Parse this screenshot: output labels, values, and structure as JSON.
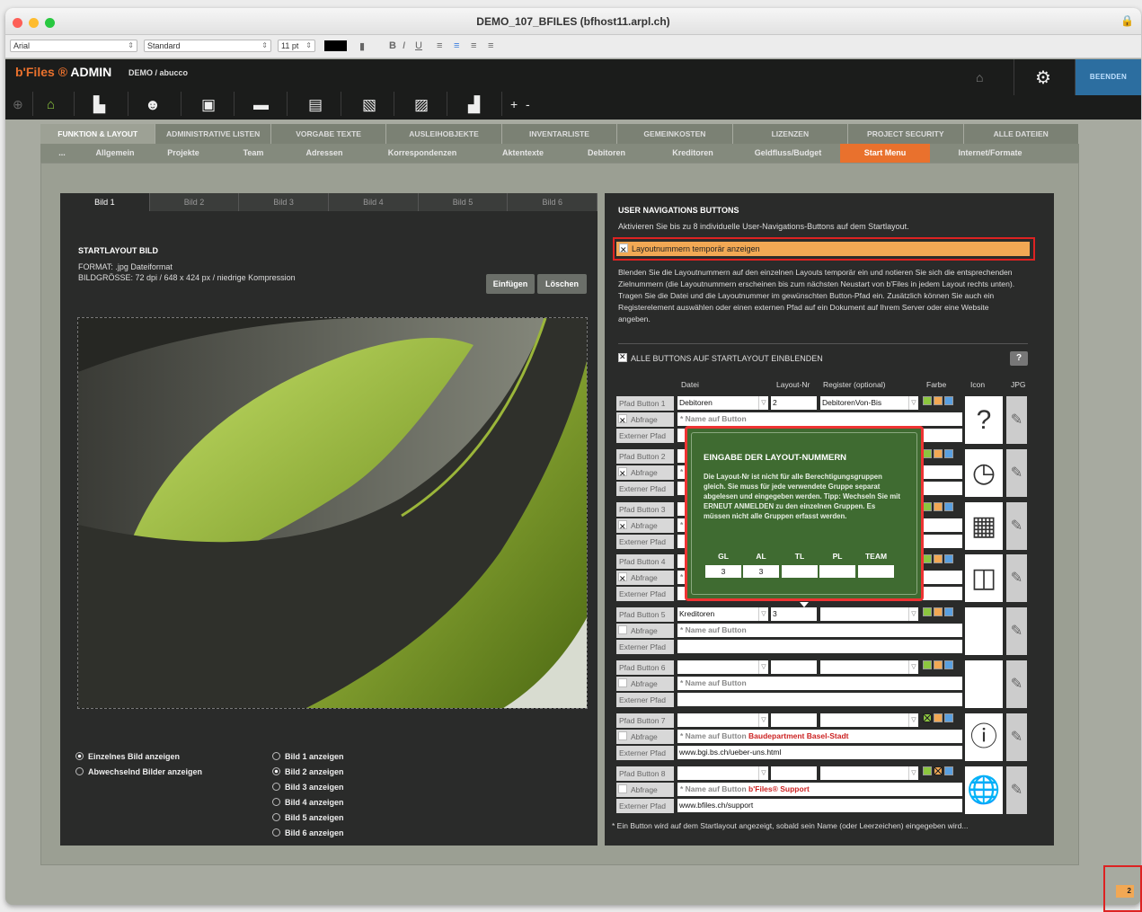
{
  "window": {
    "title": "DEMO_107_BFILES (bfhost11.arpl.ch)"
  },
  "format_bar": {
    "font": "Arial",
    "style": "Standard",
    "size": "11 pt",
    "bold": "B",
    "italic": "I",
    "underline": "U"
  },
  "app": {
    "brand_prefix": "b'Files",
    "brand_suffix": " ADMIN",
    "breadcrumb": "DEMO / abucco",
    "quit_label": "BEENDEN"
  },
  "toolbar": {
    "plus": "+",
    "minus": "-"
  },
  "tabs_main": [
    "FUNKTION & LAYOUT",
    "ADMINISTRATIVE LISTEN",
    "VORGABE TEXTE",
    "AUSLEIHOBJEKTE",
    "INVENTARLISTE",
    "GEMEINKOSTEN",
    "LIZENZEN",
    "PROJECT SECURITY",
    "ALLE DATEIEN"
  ],
  "tabs_sub": [
    "...",
    "Allgemein",
    "Projekte",
    "Team",
    "Adressen",
    "Korrespondenzen",
    "Aktentexte",
    "Debitoren",
    "Kreditoren",
    "Geldfluss/Budget",
    "Start Menu",
    "Internet/Formate"
  ],
  "left": {
    "image_tabs": [
      "Bild 1",
      "Bild 2",
      "Bild 3",
      "Bild 4",
      "Bild 5",
      "Bild 6"
    ],
    "section_title": "STARTLAYOUT BILD",
    "format_line": "FORMAT:  .jpg Dateiformat",
    "size_line": "BILDGRÖSSE: 72 dpi / 648 x 424 px / niedrige Kompression",
    "insert_button": "Einfügen",
    "delete_button": "Löschen",
    "mode_options": [
      "Einzelnes Bild anzeigen",
      "Abwechselnd Bilder anzeigen"
    ],
    "bild_options": [
      "Bild 1 anzeigen",
      "Bild 2 anzeigen",
      "Bild 3 anzeigen",
      "Bild 4 anzeigen",
      "Bild 5 anzeigen",
      "Bild 6 anzeigen"
    ]
  },
  "right": {
    "title": "USER NAVIGATIONS BUTTONS",
    "subtitle": "Aktivieren Sie bis zu 8 individuelle User-Navigations-Buttons auf dem Startlayout.",
    "highlight_checkbox": "Layoutnummern temporär anzeigen",
    "paragraph": "Blenden Sie die Layoutnummern auf den einzelnen Layouts temporär ein und notieren Sie sich die entsprechenden Zielnummern (die Layoutnummern erscheinen bis zum nächsten Neustart von b'Files in jedem Layout rechts unten). Tragen Sie die Datei und die Layoutnummer im gewünschten Button-Pfad ein. Zusätzlich können Sie auch ein Registerelement auswählen oder einen externen Pfad auf ein Dokument auf Ihrem Server oder eine Website angeben.",
    "show_all": "ALLE BUTTONS AUF STARTLAYOUT EINBLENDEN",
    "help": "?",
    "columns": {
      "datei": "Datei",
      "layout": "Layout-Nr",
      "register": "Register (optional)",
      "farbe": "Farbe",
      "icon": "Icon",
      "jpg": "JPG"
    },
    "row_labels": {
      "abfrage": "Abfrage",
      "extern": "Externer Pfad",
      "name_ph": "* Name auf Button"
    },
    "buttons": [
      {
        "label": "Pfad Button 1",
        "datei": "Debitoren",
        "layout": "2",
        "register": "DebitorenVon-Bis",
        "name": "",
        "extern": "",
        "icon": "?",
        "color_sel": -1
      },
      {
        "label": "Pfad Button 2",
        "datei": "",
        "layout": "",
        "register": "",
        "name": "",
        "extern": "",
        "icon": "◷",
        "color_sel": -1
      },
      {
        "label": "Pfad Button 3",
        "datei": "",
        "layout": "",
        "register": "",
        "name": "",
        "extern": "",
        "icon": "▦",
        "color_sel": -1
      },
      {
        "label": "Pfad Button 4",
        "datei": "",
        "layout": "",
        "register": "",
        "name": "",
        "extern": "",
        "icon": "◫",
        "color_sel": -1
      },
      {
        "label": "Pfad Button 5",
        "datei": "Kreditoren",
        "layout": "3",
        "register": "",
        "name": "",
        "extern": "",
        "icon": "",
        "color_sel": -1
      },
      {
        "label": "Pfad Button 6",
        "datei": "",
        "layout": "",
        "register": "",
        "name": "",
        "extern": "",
        "icon": "",
        "color_sel": -1
      },
      {
        "label": "Pfad Button 7",
        "datei": "",
        "layout": "",
        "register": "",
        "name": "Baudepartment Basel-Stadt",
        "extern": "www.bgi.bs.ch/ueber-uns.html",
        "icon": "ⓘ",
        "color_sel": 0
      },
      {
        "label": "Pfad Button 8",
        "datei": "",
        "layout": "",
        "register": "",
        "name": "b'Files® Support",
        "extern": "www.bfiles.ch/support",
        "icon": "🌐",
        "color_sel": 1
      }
    ],
    "footnote": "* Ein Button wird auf dem Startlayout angezeigt, sobald sein Name (oder Leerzeichen) eingegeben wird..."
  },
  "tooltip": {
    "title": "EINGABE DER LAYOUT-NUMMERN",
    "body": "Die Layout-Nr ist nicht für alle Berechtigungsgruppen gleich. Sie muss für jede verwendete Gruppe separat abgelesen und eingegeben werden. Tipp: Wechseln Sie mit ERNEUT ANMELDEN zu den einzelnen Gruppen. Es müssen nicht alle Gruppen erfasst werden.",
    "groups": [
      "GL",
      "AL",
      "TL",
      "PL",
      "TEAM"
    ],
    "values": [
      "3",
      "3",
      "",
      "",
      ""
    ]
  },
  "layout_number": "2",
  "colors": {
    "accent": "#e9712d",
    "highlight": "#f2a854",
    "tooltip": "#3f6b31",
    "error": "#dd2222"
  }
}
